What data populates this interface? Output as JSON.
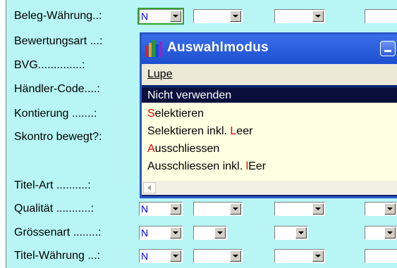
{
  "fields": {
    "beleg_waehrung": {
      "label": "Beleg-Währung..:",
      "value": "N"
    },
    "bewertungsart": {
      "label": "Bewertungsart ...:"
    },
    "bvg": {
      "label": "BVG..............:"
    },
    "haendler_code": {
      "label": "Händler-Code....:"
    },
    "kontierung": {
      "label": "Kontierung .......:"
    },
    "skontro": {
      "label": "Skontro bewegt?:"
    },
    "titel_art": {
      "label": "Titel-Art ..........:"
    },
    "qualitaet": {
      "label": "Qualität ...........:",
      "value": "N"
    },
    "groessenart": {
      "label": "Grössenart ........:",
      "value": "N"
    },
    "titel_waehrung": {
      "label": "Titel-Währung ...:",
      "value": "N"
    }
  },
  "popup": {
    "title": "Auswahlmodus",
    "menu": "Lupe",
    "options": [
      {
        "first": "",
        "rest": "Nicht verwenden",
        "pre": "",
        "hot": "",
        "post": ""
      },
      {
        "first": "S",
        "rest": "elektieren",
        "pre": "",
        "hot": "",
        "post": ""
      },
      {
        "first": "",
        "rest": "Selektieren inkl. ",
        "pre": "",
        "hot": "L",
        "post": "eer"
      },
      {
        "first": "A",
        "rest": "usschliessen",
        "pre": "",
        "hot": "",
        "post": ""
      },
      {
        "first": "",
        "rest": "Ausschliessen inkl. ",
        "pre": "",
        "hot": "l",
        "post": "Eer"
      }
    ]
  },
  "colors": {
    "background": "#b8f6f6",
    "accent_red": "#e00000",
    "value_blue": "#0000ff"
  }
}
